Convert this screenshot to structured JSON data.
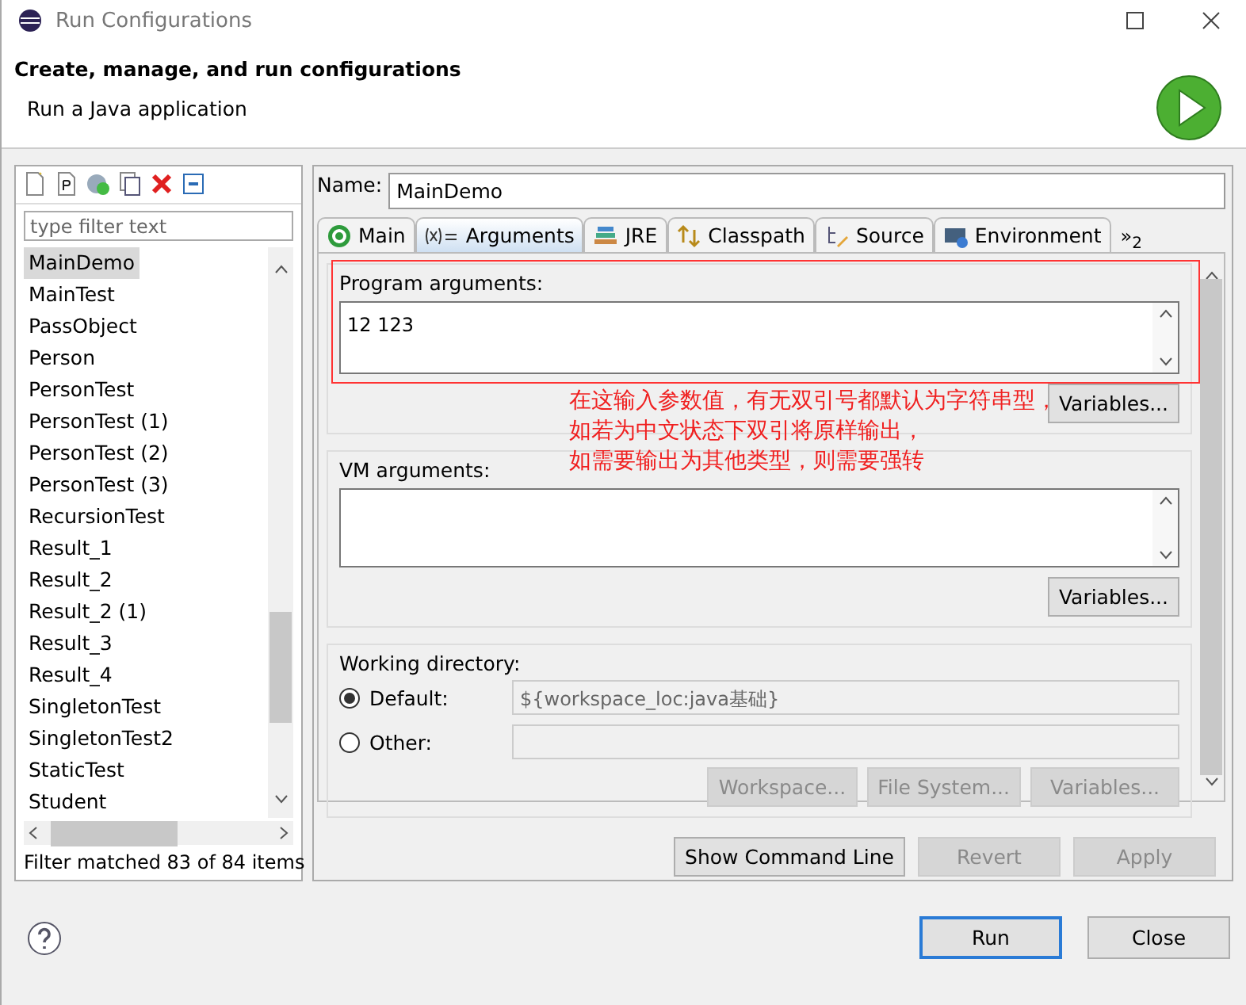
{
  "window": {
    "title": "Run Configurations"
  },
  "header": {
    "title": "Create, manage, and run configurations",
    "message": "Run a Java application"
  },
  "filter": {
    "placeholder": "type filter text"
  },
  "configurations": [
    {
      "label": "MainDemo",
      "selected": true
    },
    {
      "label": "MainTest",
      "selected": false
    },
    {
      "label": "PassObject",
      "selected": false
    },
    {
      "label": "Person",
      "selected": false
    },
    {
      "label": "PersonTest",
      "selected": false
    },
    {
      "label": "PersonTest (1)",
      "selected": false
    },
    {
      "label": "PersonTest (2)",
      "selected": false
    },
    {
      "label": "PersonTest (3)",
      "selected": false
    },
    {
      "label": "RecursionTest",
      "selected": false
    },
    {
      "label": "Result_1",
      "selected": false
    },
    {
      "label": "Result_2",
      "selected": false
    },
    {
      "label": "Result_2 (1)",
      "selected": false
    },
    {
      "label": "Result_3",
      "selected": false
    },
    {
      "label": "Result_4",
      "selected": false
    },
    {
      "label": "SingletonTest",
      "selected": false
    },
    {
      "label": "SingletonTest2",
      "selected": false
    },
    {
      "label": "StaticTest",
      "selected": false
    },
    {
      "label": "Student",
      "selected": false
    }
  ],
  "filter_status": "Filter matched 83 of 84 items",
  "name_field": {
    "label": "Name:",
    "value": "MainDemo"
  },
  "tabs": [
    {
      "label": "Main",
      "kind": "main",
      "selected": false
    },
    {
      "label": "Arguments",
      "kind": "arguments",
      "selected": true
    },
    {
      "label": "JRE",
      "kind": "jre",
      "selected": false
    },
    {
      "label": "Classpath",
      "kind": "classpath",
      "selected": false
    },
    {
      "label": "Source",
      "kind": "source",
      "selected": false
    },
    {
      "label": "Environment",
      "kind": "environment",
      "selected": false
    }
  ],
  "tab_overflow": {
    "label": "»",
    "count": "2"
  },
  "program_arguments": {
    "label": "Program arguments:",
    "value": "12 123",
    "button": "Variables..."
  },
  "annotation": [
    "在这输入参数值，有无双引号都默认为字符串型，",
    "如若为中文状态下双引将原样输出，",
    "如需要输出为其他类型，则需要强转"
  ],
  "vm_arguments": {
    "label": "VM arguments:",
    "button": "Variables..."
  },
  "working_directory": {
    "label": "Working directory:",
    "options": [
      {
        "label": "Default:",
        "selected": true,
        "value": "${workspace_loc:java基础}"
      },
      {
        "label": "Other:",
        "selected": false
      }
    ],
    "buttons": [
      {
        "label": "Workspace...",
        "disabled": true
      },
      {
        "label": "File System...",
        "disabled": true
      },
      {
        "label": "Variables...",
        "disabled": true
      }
    ]
  },
  "actions": [
    {
      "label": "Show Command Line",
      "disabled": false
    },
    {
      "label": "Revert",
      "disabled": true
    },
    {
      "label": "Apply",
      "disabled": true
    }
  ],
  "dialog_buttons": [
    {
      "label": "Run",
      "default": true
    },
    {
      "label": "Close",
      "default": false
    }
  ]
}
